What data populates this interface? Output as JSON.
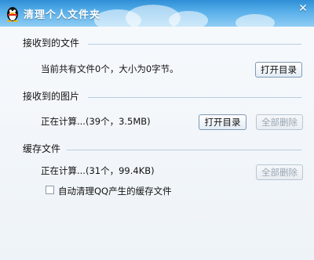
{
  "window": {
    "title": "清理个人文件夹",
    "app_icon": "qq-penguin-icon",
    "close_icon": "close-icon"
  },
  "received_files": {
    "heading": "接收到的文件",
    "status": "当前共有文件0个，大小为0字节。",
    "open_dir_label": "打开目录"
  },
  "received_images": {
    "heading": "接收到的图片",
    "status": "正在计算...(39个，3.5MB)",
    "open_dir_label": "打开目录",
    "delete_all_label": "全部删除"
  },
  "cache_files": {
    "heading": "缓存文件",
    "status": "正在计算...(31个，99.4KB)",
    "delete_all_label": "全部删除",
    "auto_clean_label": "自动清理QQ产生的缓存文件",
    "auto_clean_checked": false
  },
  "colors": {
    "titlebar": "#3a97dc",
    "divider": "#b8cde0",
    "background": "#eef3f8"
  }
}
